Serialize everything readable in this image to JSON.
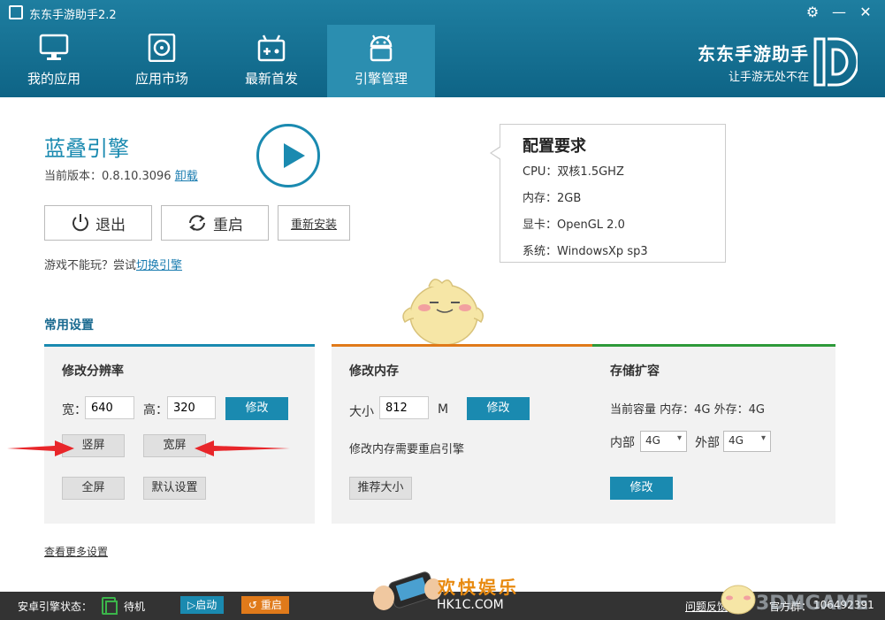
{
  "window": {
    "title": "东东手游助手2.2"
  },
  "nav": {
    "tabs": [
      {
        "label": "我的应用"
      },
      {
        "label": "应用市场"
      },
      {
        "label": "最新首发"
      },
      {
        "label": "引擎管理"
      }
    ]
  },
  "brand": {
    "name": "东东手游助手",
    "slogan": "让手游无处不在"
  },
  "engine": {
    "name": "蓝叠引擎",
    "version_label": "当前版本：",
    "version": "0.8.10.3096",
    "uninstall": "卸载",
    "exit": "退出",
    "restart": "重启",
    "reinstall": "重新安装",
    "hint_prefix": "游戏不能玩？尝试",
    "hint_link": "切换引擎"
  },
  "requirements": {
    "title": "配置要求",
    "items": [
      "CPU：双核1.5GHZ",
      "内存：2GB",
      "显卡：OpenGL 2.0",
      "系统：WindowsXp sp3"
    ]
  },
  "settings": {
    "title": "常用设置",
    "resolution": {
      "title": "修改分辨率",
      "width_label": "宽：",
      "width": "640",
      "height_label": "高：",
      "height": "320",
      "modify": "修改",
      "portrait": "竖屏",
      "landscape": "宽屏",
      "fullscreen": "全屏",
      "default": "默认设置"
    },
    "memory": {
      "title": "修改内存",
      "size_label": "大小",
      "size": "812",
      "unit": "M",
      "modify": "修改",
      "note": "修改内存需要重启引擎",
      "recommend": "推荐大小"
    },
    "storage": {
      "title": "存储扩容",
      "capacity": "当前容量 内存：4G 外存：4G",
      "internal_label": "内部",
      "internal": "4G",
      "external_label": "外部",
      "external": "4G",
      "modify": "修改"
    },
    "more": "查看更多设置"
  },
  "status": {
    "label": "安卓引擎状态：",
    "state": "待机",
    "start": "▷启动",
    "restart": "↺ 重启",
    "feedback": "问题反馈",
    "official": "官方群：",
    "qq": "106492391"
  },
  "ad": {
    "cn": "欢快娱乐",
    "url": "HK1C.COM"
  },
  "watermark": "3DMGAME",
  "colors": {
    "primary": "#1a8ab0",
    "orange": "#e07a1a",
    "green": "#2e9a3a"
  }
}
